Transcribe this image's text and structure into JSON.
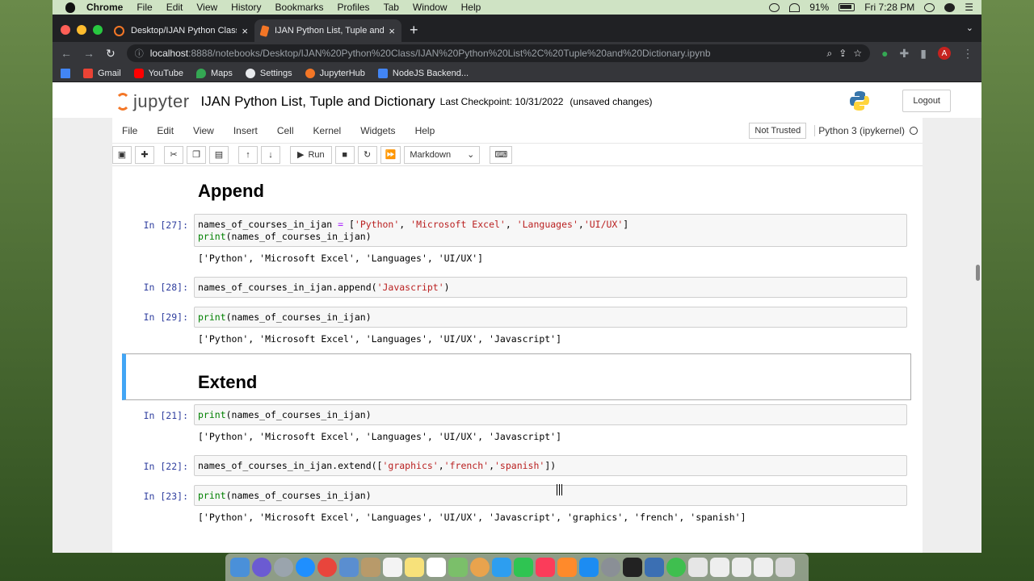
{
  "menubar": {
    "app": "Chrome",
    "items": [
      "File",
      "Edit",
      "View",
      "History",
      "Bookmarks",
      "Profiles",
      "Tab",
      "Window",
      "Help"
    ],
    "battery": "91%",
    "clock": "Fri 7:28 PM"
  },
  "tabs": [
    {
      "label": "Desktop/IJAN Python Class/",
      "close": "×"
    },
    {
      "label": "IJAN Python List, Tuple and Di",
      "close": "×"
    }
  ],
  "new_tab": "+",
  "address": {
    "host": "localhost",
    "rest": ":8888/notebooks/Desktop/IJAN%20Python%20Class/IJAN%20Python%20List%2C%20Tuple%20and%20Dictionary.ipynb"
  },
  "profile_initial": "A",
  "bookmarks": [
    {
      "label": "Gmail",
      "color": "#ea4335"
    },
    {
      "label": "YouTube",
      "color": "#ff0000"
    },
    {
      "label": "Maps",
      "color": "#34a853"
    },
    {
      "label": "Settings",
      "color": "#e8eaed"
    },
    {
      "label": "JupyterHub",
      "color": "#f37626"
    },
    {
      "label": "NodeJS Backend...",
      "color": "#4285f4"
    }
  ],
  "jupyter": {
    "logo_text": "jupyter",
    "notebook_title": "IJAN Python List, Tuple and Dictionary",
    "checkpoint": "Last Checkpoint: 10/31/2022",
    "unsaved": "(unsaved changes)",
    "logout": "Logout",
    "menu": [
      "File",
      "Edit",
      "View",
      "Insert",
      "Cell",
      "Kernel",
      "Widgets",
      "Help"
    ],
    "trusted": "Not Trusted",
    "kernel": "Python 3 (ipykernel)",
    "toolbar": {
      "run": "Run",
      "cell_type": "Markdown"
    }
  },
  "notebook": {
    "heading_append": "Append",
    "heading_extend": "Extend",
    "cells": [
      {
        "prompt": "In [27]:",
        "output": "['Python', 'Microsoft Excel', 'Languages', 'UI/UX']"
      },
      {
        "prompt": "In [28]:"
      },
      {
        "prompt": "In [29]:",
        "output": "['Python', 'Microsoft Excel', 'Languages', 'UI/UX', 'Javascript']"
      },
      {
        "prompt": "In [21]:",
        "output": "['Python', 'Microsoft Excel', 'Languages', 'UI/UX', 'Javascript']"
      },
      {
        "prompt": "In [22]:"
      },
      {
        "prompt": "In [23]:",
        "output": "['Python', 'Microsoft Excel', 'Languages', 'UI/UX', 'Javascript', 'graphics', 'french', 'spanish']"
      }
    ],
    "code": {
      "c27_l1_a": "names_of_courses_in_ijan ",
      "c27_l1_op": "=",
      "c27_l1_b": " [",
      "c27_s1": "'Python'",
      "c27_s2": "'Microsoft Excel'",
      "c27_s3": "'Languages'",
      "c27_s4": "'UI/UX'",
      "c27_end": "]",
      "print_kw": "print",
      "print_arg": "(names_of_courses_in_ijan)",
      "c28_a": "names_of_courses_in_ijan.append(",
      "c28_s": "'Javascript'",
      "c28_b": ")",
      "c22_a": "names_of_courses_in_ijan.extend([",
      "c22_s1": "'graphics'",
      "c22_s2": "'french'",
      "c22_s3": "'spanish'",
      "c22_b": "])"
    }
  }
}
